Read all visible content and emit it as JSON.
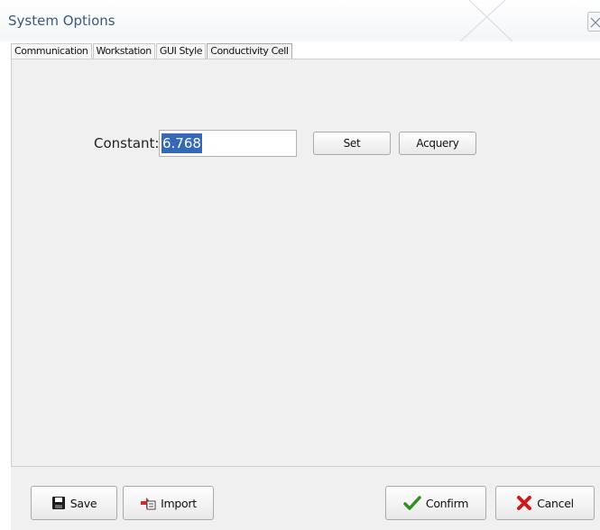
{
  "window": {
    "title": "System Options"
  },
  "tabs": [
    {
      "label": "Communication"
    },
    {
      "label": "Workstation"
    },
    {
      "label": "GUI Style"
    },
    {
      "label": "Conductivity Cell"
    }
  ],
  "active_tab": "Conductivity Cell",
  "constant": {
    "label": "Constant:",
    "value": "6.768"
  },
  "buttons": {
    "set": "Set",
    "acquery": "Acquery",
    "save": "Save",
    "import": "Import",
    "confirm": "Confirm",
    "cancel": "Cancel"
  },
  "icons": {
    "close": "close-icon",
    "save": "floppy-disk-icon",
    "import": "import-icon",
    "confirm": "checkmark-icon",
    "cancel": "red-x-icon"
  },
  "colors": {
    "title_text": "#3c5a7a",
    "selection": "#3569b8",
    "confirm_green": "#2f8f1f",
    "cancel_red": "#cc1a1a"
  }
}
